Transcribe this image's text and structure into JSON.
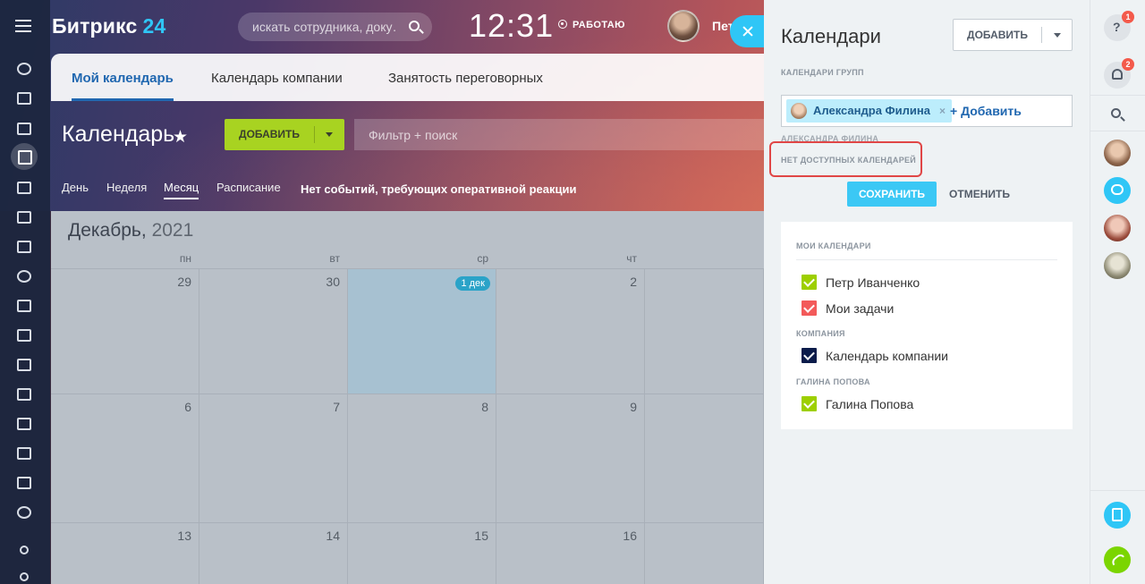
{
  "header": {
    "logo_main": "Битрикс",
    "logo_num": "24",
    "search_placeholder": "искать сотрудника, доку…",
    "clock": "12:31",
    "work_status": "РАБОТАЮ",
    "user_name": "Петр Иванченко"
  },
  "calendar": {
    "tabs": [
      {
        "label": "Мой календарь",
        "active": true
      },
      {
        "label": "Календарь компании",
        "active": false
      },
      {
        "label": "Занятость переговорных",
        "active": false
      }
    ],
    "title": "Календарь",
    "add_label": "ДОБАВИТЬ",
    "filter_placeholder": "Фильтр + поиск",
    "views": [
      {
        "label": "День",
        "active": false
      },
      {
        "label": "Неделя",
        "active": false
      },
      {
        "label": "Месяц",
        "active": true
      },
      {
        "label": "Расписание",
        "active": false
      }
    ],
    "no_events": "Нет событий, требующих оперативной реакции",
    "month": "Декабрь,",
    "year": "2021",
    "weekdays": [
      "пн",
      "вт",
      "ср",
      "чт"
    ],
    "weeks": [
      [
        "29",
        "30",
        "1 дек",
        "2"
      ],
      [
        "6",
        "7",
        "8",
        "9"
      ],
      [
        "13",
        "14",
        "15",
        "16"
      ]
    ],
    "today": "1 дек"
  },
  "panel": {
    "title": "Календари",
    "add_label": "ДОБАВИТЬ",
    "group_section": "КАЛЕНДАРИ ГРУПП",
    "selected_user": "Александра Филина",
    "add_link": "+ Добавить",
    "user_section": "АЛЕКСАНДРА ФИЛИНА",
    "no_calendars": "НЕТ ДОСТУПНЫХ КАЛЕНДАРЕЙ",
    "save_label": "СОХРАНИТЬ",
    "cancel_label": "ОТМЕНИТЬ",
    "my_calendars_label": "МОИ КАЛЕНДАРИ",
    "my_calendars": [
      {
        "name": "Петр Иванченко",
        "color": "#9dcf00"
      },
      {
        "name": "Мои задачи",
        "color": "#f35a5a"
      }
    ],
    "company_label": "КОМПАНИЯ",
    "company_calendars": [
      {
        "name": "Календарь компании",
        "color": "#0b1b4a"
      }
    ],
    "galina_label": "ГАЛИНА ПОПОВА",
    "galina_calendars": [
      {
        "name": "Галина Попова",
        "color": "#9dcf00"
      }
    ]
  },
  "rightbar": {
    "help_badge": "1",
    "notify_badge": "2"
  },
  "colors": {
    "accent": "#2fc6f6",
    "add_green": "#a8d321",
    "link_blue": "#2067b0"
  }
}
